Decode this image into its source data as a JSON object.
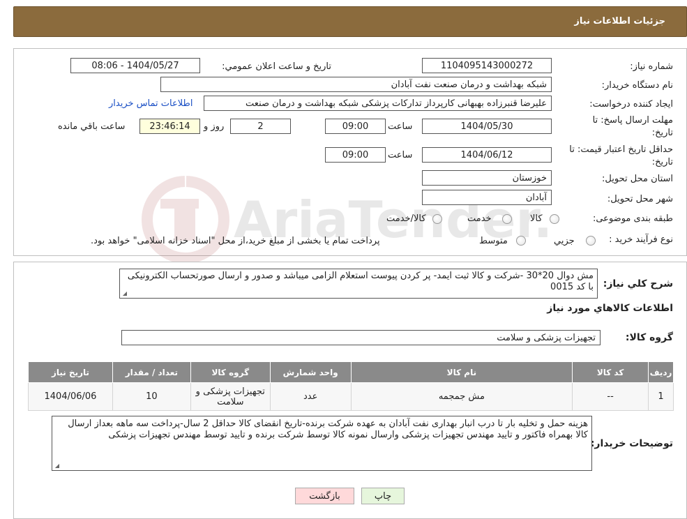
{
  "header": {
    "title": "جزئیات اطلاعات نیاز"
  },
  "form": {
    "need_number_label": "شماره نیاز:",
    "need_number": "1104095143000272",
    "announce_label": "تاریخ و ساعت اعلان عمومي:",
    "announce_value": "1404/05/27 - 08:06",
    "buyer_org_label": "نام دستگاه خریدار:",
    "buyer_org": "شبکه بهداشت و درمان صنعت نفت آبادان",
    "creator_label": "ایجاد کننده درخواست:",
    "creator": "علیرضا قنبرزاده بهبهانی کارپرداز تدارکات پزشکی شبکه بهداشت و درمان صنعت",
    "contact_link": "اطلاعات تماس خریدار",
    "deadline_label": "مهلت ارسال پاسخ: تا",
    "deadline_label2": "تاریخ:",
    "deadline_date": "1404/05/30",
    "time_label": "ساعت",
    "deadline_time": "09:00",
    "days_value": "2",
    "days_label": "روز و",
    "remaining_time": "23:46:14",
    "remaining_label": "ساعت باقي مانده",
    "validity_label": "حداقل تاریخ اعتبار قیمت: تا",
    "validity_label2": "تاریخ:",
    "validity_date": "1404/06/12",
    "validity_time": "09:00",
    "province_label": "استان محل تحویل:",
    "province": "خوزستان",
    "city_label": "شهر محل تحویل:",
    "city": "آبادان",
    "category_label": "طبقه بندی موضوعی:",
    "category_options": [
      "کالا",
      "خدمت",
      "کالا/خدمت"
    ],
    "process_label": "نوع فرآیند خرید :",
    "process_options": [
      "جزیي",
      "متوسط"
    ],
    "process_note": "پرداخت تمام یا بخشی از مبلغ خرید،از محل \"اسناد خزانه اسلامی\" خواهد بود."
  },
  "summary": {
    "label": "شرح كلي نياز:",
    "text": "مش دوال 20*30 -شرکت و کالا ثبت ایمد- پر کردن پیوست استعلام الزامی میباشد و  صدور  و ارسال صورتحساب الکترونیکی با کد 0015"
  },
  "goods": {
    "section_title": "اطلاعات كالاهاي مورد نياز",
    "group_label": "گروه کالا:",
    "group_value": "تجهیزات پزشکی و سلامت",
    "columns": [
      "ردیف",
      "کد کالا",
      "نام کالا",
      "واحد شمارش",
      "گروه کالا",
      "تعداد / مقدار",
      "تاریخ نیاز"
    ],
    "rows": [
      {
        "row": "1",
        "code": "--",
        "name": "مش جمجمه",
        "unit": "عدد",
        "group": "تجهیزات پزشکی و سلامت",
        "qty": "10",
        "date": "1404/06/06"
      }
    ]
  },
  "buyer_notes": {
    "label": "توضیحات خریدار:",
    "text": "هزینه حمل و تخلیه بار تا درب انبار بهداری نفت آبادان به عهده شرکت برنده-تاریخ انقضای کالا حداقل 2 سال-پرداخت سه ماهه بعداز ارسال کالا بهمراه فاکتور و تایید مهندس تجهیزات پزشکی وارسال نمونه کالا توسط شرکت برنده و تایید توسط مهندس تجهیزات پزشکی"
  },
  "actions": {
    "print": "چاپ",
    "back": "بازگشت"
  },
  "colors": {
    "header_bg": "#8B6B3D",
    "back_bg": "#FFD9DA",
    "print_bg": "#E6F6DC",
    "table_header": "#8A8A8A"
  },
  "watermark": {
    "text": "AriaTender.neT"
  }
}
